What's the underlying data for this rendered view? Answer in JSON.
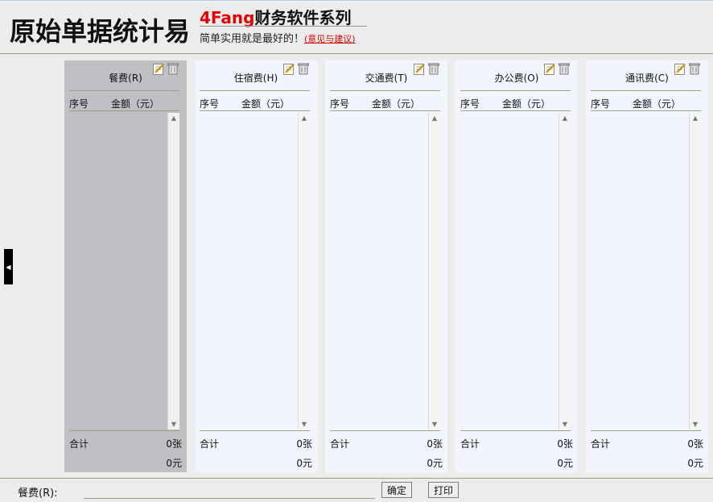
{
  "header": {
    "app_title": "原始单据统计易",
    "brand_accent": "4Fang",
    "brand_rest": "财务软件系列",
    "slogan": "简单实用就是最好的！",
    "feedback_link": "(意见与建议)"
  },
  "columns": {
    "no": "序号",
    "amount": "金额（元）"
  },
  "totals_label": "合计",
  "panels": [
    {
      "title": "餐费(R)",
      "count": "0张",
      "amount": "0元",
      "selected": true
    },
    {
      "title": "住宿费(H)",
      "count": "0张",
      "amount": "0元",
      "selected": false
    },
    {
      "title": "交通费(T)",
      "count": "0张",
      "amount": "0元",
      "selected": false
    },
    {
      "title": "办公费(O)",
      "count": "0张",
      "amount": "0元",
      "selected": false
    },
    {
      "title": "通讯费(C)",
      "count": "0张",
      "amount": "0元",
      "selected": false
    }
  ],
  "footer": {
    "label": "餐费(R):",
    "input_value": "",
    "confirm": "确定",
    "print": "打印"
  },
  "colors": {
    "accent_red": "#e30000",
    "divider_olive": "#9ba37a",
    "panel_bg": "#f3f5fe",
    "panel_selected_bg": "#bfc0c3"
  },
  "icons": {
    "edit": "edit-icon",
    "delete": "delete-icon",
    "collapse": "collapse-left-icon"
  }
}
